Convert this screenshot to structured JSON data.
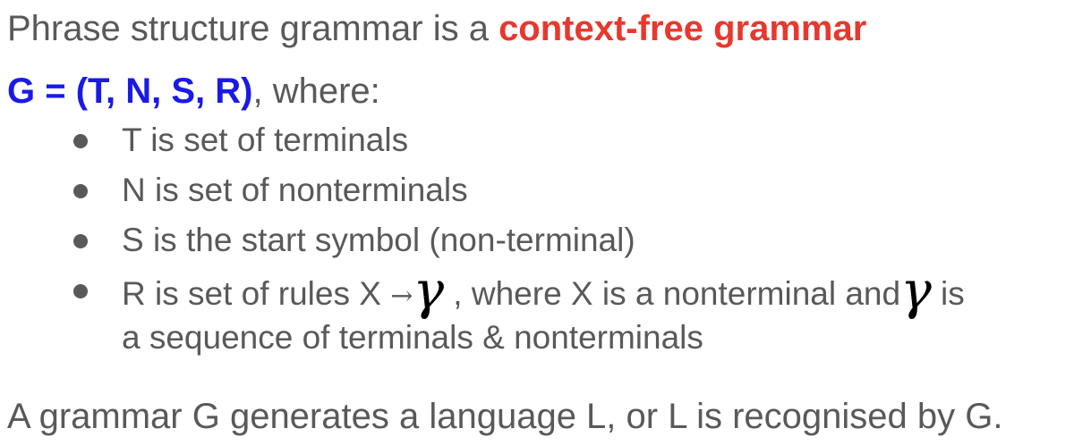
{
  "intro": {
    "prefix": "Phrase structure grammar is a ",
    "highlight": "context-free grammar"
  },
  "definition": {
    "tuple": "G = (T, N, S, R)",
    "suffix": ", where:"
  },
  "bullets": [
    {
      "text": "T is set of terminals"
    },
    {
      "text": "N is set of nonterminals"
    },
    {
      "text": "S is the start symbol (non-terminal)"
    },
    {
      "text_before": "R is set of rules X ",
      "arrow": "→",
      "gamma": "γ",
      "text_middle": " , where X is a nonterminal and",
      "gamma2": "γ",
      "text_end": " is",
      "text_wrap": "a sequence of terminals & nonterminals"
    }
  ],
  "conclusion": "A grammar G generates a language L, or L is recognised by G.",
  "colors": {
    "body_text": "#595959",
    "highlight_red": "#e8382d",
    "highlight_blue": "#1a1ae6",
    "gamma": "#000000"
  }
}
